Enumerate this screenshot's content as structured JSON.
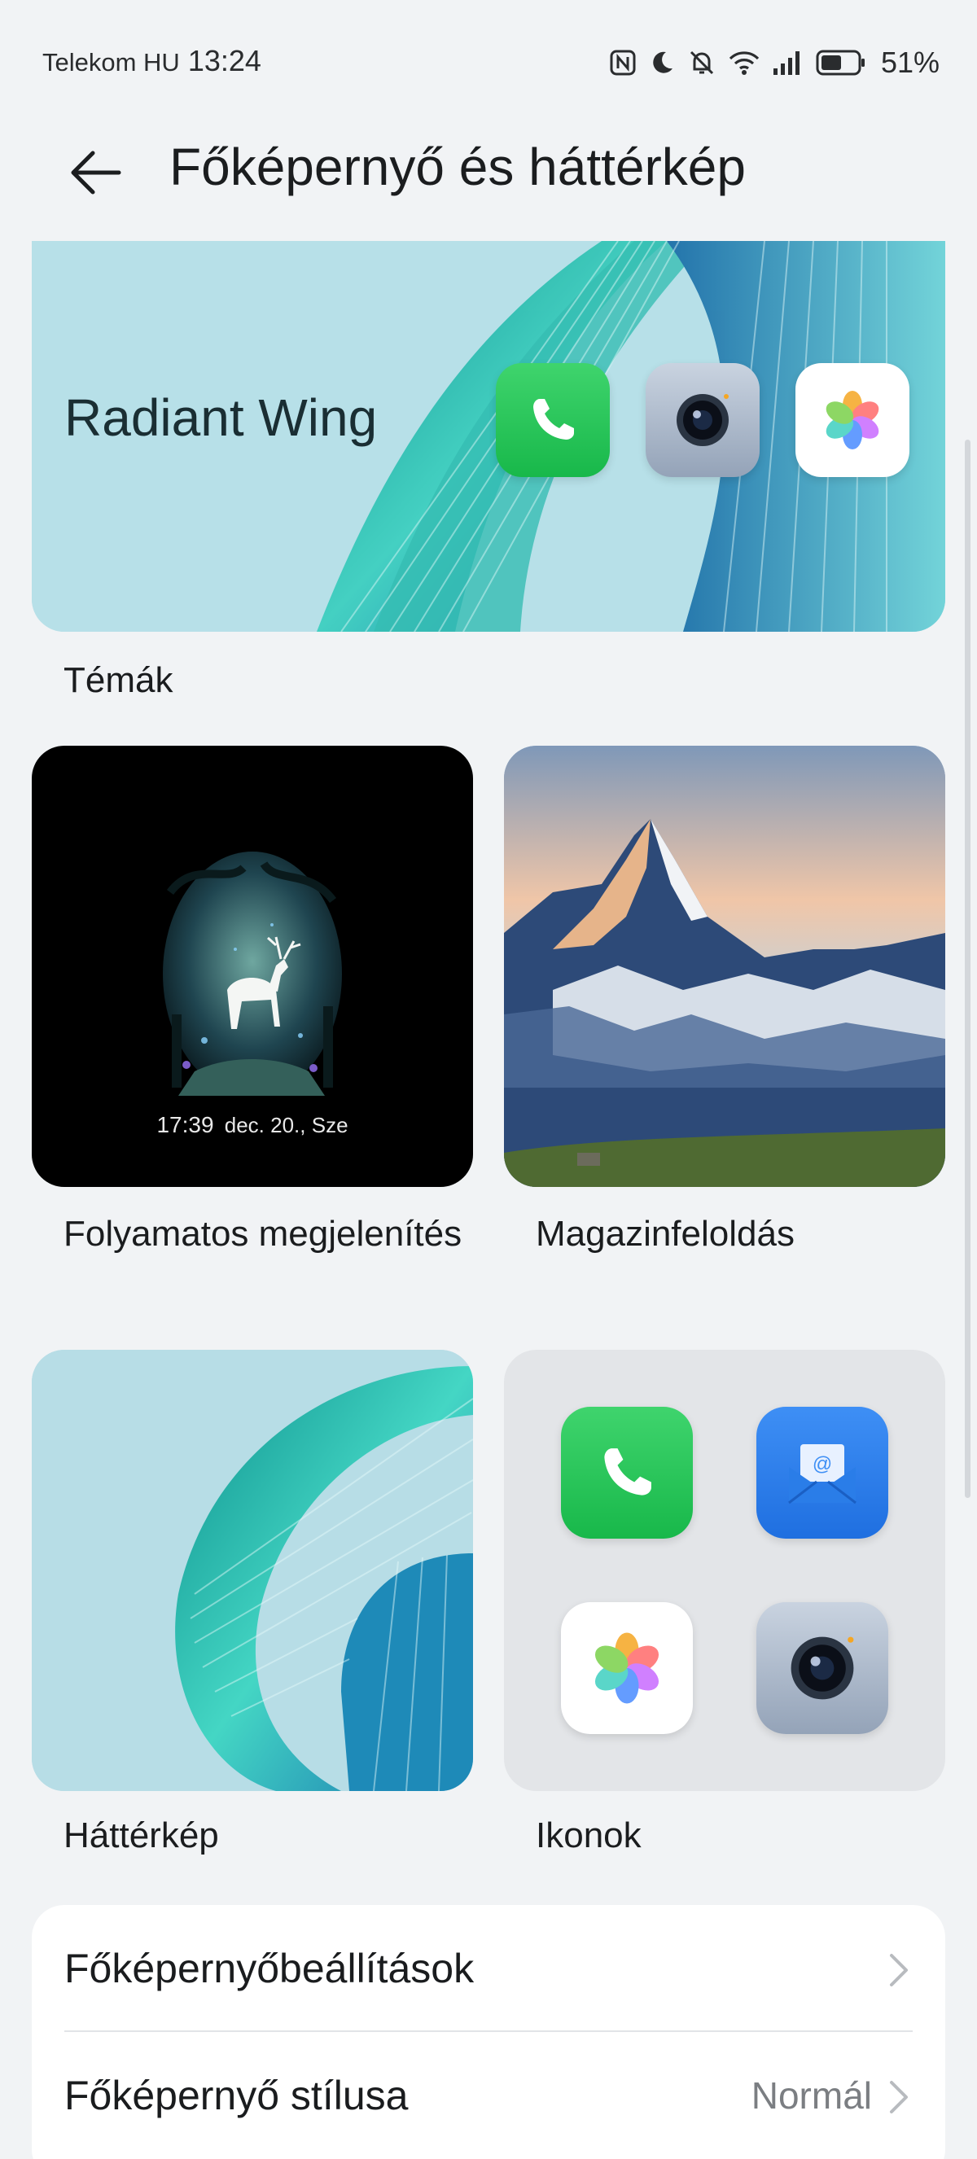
{
  "status_bar": {
    "carrier": "Telekom HU",
    "time": "13:24",
    "battery_percent": "51%",
    "icons": [
      "nfc-icon",
      "moon-icon",
      "bell-off-icon",
      "wifi-icon",
      "signal-icon",
      "battery-icon"
    ]
  },
  "header": {
    "title": "Főképernyő és háttérkép",
    "back_icon": "arrow-left-icon"
  },
  "themes": {
    "theme_name": "Radiant Wing",
    "label": "Témák",
    "icons": [
      "phone-icon",
      "camera-icon",
      "gallery-icon"
    ]
  },
  "always_on_display": {
    "label": "Folyamatos megjelenítés",
    "preview_time": "17:39",
    "preview_date": "dec. 20., Sze"
  },
  "magazine_unlock": {
    "label": "Magazinfeloldás"
  },
  "wallpaper": {
    "label": "Háttérkép"
  },
  "icons_section": {
    "label": "Ikonok",
    "icons": [
      "phone-icon",
      "mail-icon",
      "gallery-icon",
      "camera-icon"
    ]
  },
  "settings": {
    "home_settings_label": "Főképernyőbeállítások",
    "home_style_label": "Főképernyő stílusa",
    "home_style_value": "Normál"
  },
  "colors": {
    "background": "#f1f3f5",
    "phone_green": "#18b84a",
    "mail_blue": "#1f6fe0",
    "theme_teal": "#1aa7a0"
  }
}
